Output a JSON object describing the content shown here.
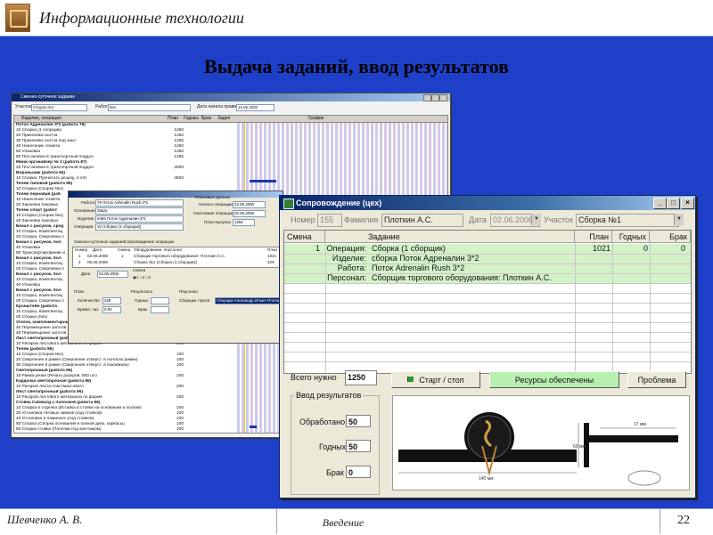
{
  "slide": {
    "header_title": "Информационные технологии",
    "title": "Выдача заданий, ввод результатов",
    "author": "Шевченко А. В.",
    "section": "Введение",
    "page": "22"
  },
  "back_window": {
    "title": "Сменно-суточное задание",
    "filter_labels": [
      "Участок",
      "Сборка №1",
      "Работа",
      "Все",
      "Дата начала правила",
      "16.06.2006"
    ],
    "columns": [
      "Изделие, операция",
      "План",
      "Годных",
      "Брак",
      "Задел",
      "График"
    ],
    "rows": [
      {
        "name": "Поток Адреналин 3*2 (работа 76)",
        "qty": "",
        "bold": true
      },
      {
        "name": "10 Сборка (1 сборщик)",
        "qty": "1250",
        "bold": false
      },
      {
        "name": "20 Приклейка скотча",
        "qty": "1250",
        "bold": false
      },
      {
        "name": "30 Приклейка скотча под закл",
        "qty": "1250",
        "bold": false
      },
      {
        "name": "40 Нанесение этикета",
        "qty": "1250",
        "bold": false
      },
      {
        "name": "50 Упаковка",
        "qty": "1250",
        "bold": false
      },
      {
        "name": "60 Постановка в транспортный поддон",
        "qty": "1250",
        "bold": false
      },
      {
        "name": "Мини органайзер № 2 (работа 87)",
        "qty": "",
        "bold": true
      },
      {
        "name": "40 Постановка в транспортный поддон",
        "qty": "3000",
        "bold": false
      },
      {
        "name": "Вороньшик (работа 94)",
        "qty": "",
        "bold": true
      },
      {
        "name": "10 Сборка. Прочитать резьбу, 4 отв",
        "qty": "4500",
        "bold": false
      },
      {
        "name": "Тележ типовой (работа 95)",
        "qty": "",
        "bold": true
      },
      {
        "name": "10 Сборка (Сборка №1)",
        "qty": "",
        "bold": false
      },
      {
        "name": "Тележ перновая (раб",
        "qty": "",
        "bold": true
      },
      {
        "name": "10 Нанесение этикета",
        "qty": "",
        "bold": false
      },
      {
        "name": "20 Заклейка боковых",
        "qty": "",
        "bold": false
      },
      {
        "name": "Тележ спорт (работ",
        "qty": "",
        "bold": true
      },
      {
        "name": "10 Сборка (Сборка №1)",
        "qty": "",
        "bold": false
      },
      {
        "name": "40 Заклейка боковых",
        "qty": "",
        "bold": false
      },
      {
        "name": "Бокал с рисунок, сред",
        "qty": "",
        "bold": true
      },
      {
        "name": "10 Сборка, Комплектац",
        "qty": "",
        "bold": false
      },
      {
        "name": "20 Сборка, Сверлевка п",
        "qty": "",
        "bold": false
      },
      {
        "name": "Бокал с рисунок, бол",
        "qty": "",
        "bold": true
      },
      {
        "name": "40 Упаковка",
        "qty": "",
        "bold": false
      },
      {
        "name": "50 Транспортирование и",
        "qty": "",
        "bold": false
      },
      {
        "name": "Бокал с рисунок, бол",
        "qty": "",
        "bold": true
      },
      {
        "name": "10 Сборка, Комплектац",
        "qty": "",
        "bold": false
      },
      {
        "name": "20 Сборка, Сверлевка п",
        "qty": "",
        "bold": false
      },
      {
        "name": "Бокал с рисунок, бол",
        "qty": "",
        "bold": true
      },
      {
        "name": "10 Сборка, Комплектац",
        "qty": "",
        "bold": false
      },
      {
        "name": "40 Упаковка",
        "qty": "",
        "bold": false
      },
      {
        "name": "Бокал с рисунок, бол",
        "qty": "",
        "bold": true
      },
      {
        "name": "10 Сборка, Комплектац",
        "qty": "",
        "bold": false
      },
      {
        "name": "20 Сборка, Сверлевка п",
        "qty": "",
        "bold": false
      },
      {
        "name": "Кронштейн (работа",
        "qty": "",
        "bold": true
      },
      {
        "name": "10 Сборка, Комплектац",
        "qty": "",
        "bold": false
      },
      {
        "name": "20 Сборка (без)",
        "qty": "",
        "bold": false
      },
      {
        "name": "Уголок, комплементарный",
        "qty": "",
        "bold": true
      },
      {
        "name": "40 Перемещение заготов",
        "qty": "",
        "bold": false
      },
      {
        "name": "40 Перемещение заготов",
        "qty": "",
        "bold": false
      },
      {
        "name": "Лист светопрочный (работа 95)",
        "qty": "",
        "bold": true
      },
      {
        "name": "10 Раскрой листового материала по форме",
        "qty": "200",
        "bold": false
      },
      {
        "name": "Тележ (работа 96)",
        "qty": "",
        "bold": true
      },
      {
        "name": "10 Сборка (Сборка №1)",
        "qty": "100",
        "bold": false
      },
      {
        "name": "20 Сверление в рамке (Сверление отверст. в полосах рамки)",
        "qty": "100",
        "bold": false
      },
      {
        "name": "30 Сверление в рамке (Сверление отверст. в боковинах)",
        "qty": "100",
        "bold": false
      },
      {
        "name": "Светопрочный (работа 96)",
        "qty": "",
        "bold": true
      },
      {
        "name": "10 Рамка резки (Резать раскрой, 500 шт)",
        "qty": "100",
        "bold": false
      },
      {
        "name": "Кардочка светопрочная (работа 96)",
        "qty": "",
        "bold": true
      },
      {
        "name": "10 Раскрой листа пластмассового",
        "qty": "200",
        "bold": false
      },
      {
        "name": "Лист светопрочный (работа 96)",
        "qty": "",
        "bold": true
      },
      {
        "name": "10 Раскрой листового материала по форме",
        "qty": "200",
        "bold": false
      },
      {
        "name": "Стойка Cabiburg с полочкой (работа 96)",
        "qty": "",
        "bold": true
      },
      {
        "name": "10 Сборка и отделка (Вставка в стойки на основании и полкой)",
        "qty": "100",
        "bold": false
      },
      {
        "name": "20 Установка тяговых замков (под стойкой)",
        "qty": "100",
        "bold": false
      },
      {
        "name": "40 Установка в ламинате (под стойкой)",
        "qty": "100",
        "bold": false
      },
      {
        "name": "50 Сборка (Сборка основания в полкой диск, каркасы)",
        "qty": "100",
        "bold": false
      },
      {
        "name": "60 Сборка стойки (Полочки под монтажом)",
        "qty": "100",
        "bold": false
      }
    ]
  },
  "middle_dialog": {
    "work_label": "Работа",
    "work_value": "76 Поток Adrenalin Rush 3*2",
    "base_label": "Основание",
    "base_value": "Заказ",
    "product_label": "Изделие",
    "product_value": "5466 Поток Адреналин 3*2",
    "operation_label": "Операция",
    "operation_value": "10 (Сборка (1 сборщик))",
    "plan_group": "Плановые данные",
    "start_label": "Начало операции",
    "start_value": "02.06.2006",
    "end_label": "Окончание операции",
    "end_value": "02.06.2006",
    "output_label": "План выпуска",
    "output_value": "1250",
    "tab1": "Сменно-суточные задания",
    "tab2": "Сопровождение операции",
    "grid_cols": [
      "Номер",
      "Дата",
      "Смена",
      "Оборудование, персонал",
      "План"
    ],
    "grid_rows": [
      [
        "1",
        "02.06.2006",
        "1",
        "Сборщик торгового оборудования: Плоткин А.С.",
        "1021"
      ],
      [
        "2",
        "05.06.2006",
        "",
        "Сборка №1 (Сборка (1 сборщик))",
        "229"
      ]
    ],
    "date_label": "Дата",
    "date_value": "02.06.2006",
    "shift_label": "Смена",
    "plan_label": "План",
    "qty_label": "Количество",
    "qty_value": "229",
    "time_label": "Время, час",
    "time_value": "0.00",
    "results_label": "Результаты",
    "good_label": "Годных",
    "defect_label": "Брак",
    "personnel_label": "Персонал",
    "worker_label": "Сборщик торгов",
    "worker_value": "Сборщик Александр Ильич Плоткин"
  },
  "front_window": {
    "title": "Сопровождение (цех)",
    "number_label": "Номер",
    "number_value": "155",
    "surname_label": "Фамилия",
    "surname_value": "Плоткин А.С.",
    "date_label": "Дата",
    "date_value": "02.06.2006",
    "section_label": "Участок",
    "section_value": "Сборка №1",
    "columns": [
      "Смена",
      "Задание",
      "План",
      "Годных",
      "Брак"
    ],
    "row_main": {
      "shift": "1",
      "label": "Операция:",
      "task": "Сборка (1 сборщик)",
      "plan": "1021",
      "good": "0",
      "defect": "0"
    },
    "sub_rows": [
      {
        "label": "Изделие:",
        "value": "сборка Поток Адреналин 3*2"
      },
      {
        "label": "Работа:",
        "value": "Поток Adrenalin Rush 3*2"
      },
      {
        "label": "Персонал:",
        "value": "Сборщик торгового оборудования: Плоткин А.С."
      }
    ],
    "total_label": "Всего нужно",
    "total_value": "1250",
    "start_stop": "Старт / стоп",
    "resources": "Ресурсы обеспечены",
    "problem": "Проблема",
    "results_group": "Ввод результатов",
    "processed_label": "Обработано",
    "processed_value": "50",
    "good_label": "Годных",
    "good_value": "50",
    "defect_label": "Брак",
    "defect_value": "0",
    "drawing_dims": [
      "140 мм",
      "17 мм",
      "60 мм"
    ]
  },
  "colors": {
    "slide_blue": "#1e40c8",
    "resources_green": "#b8f0b0",
    "grid_green": "#d4f2c8",
    "titlebar": "#0a246a"
  }
}
